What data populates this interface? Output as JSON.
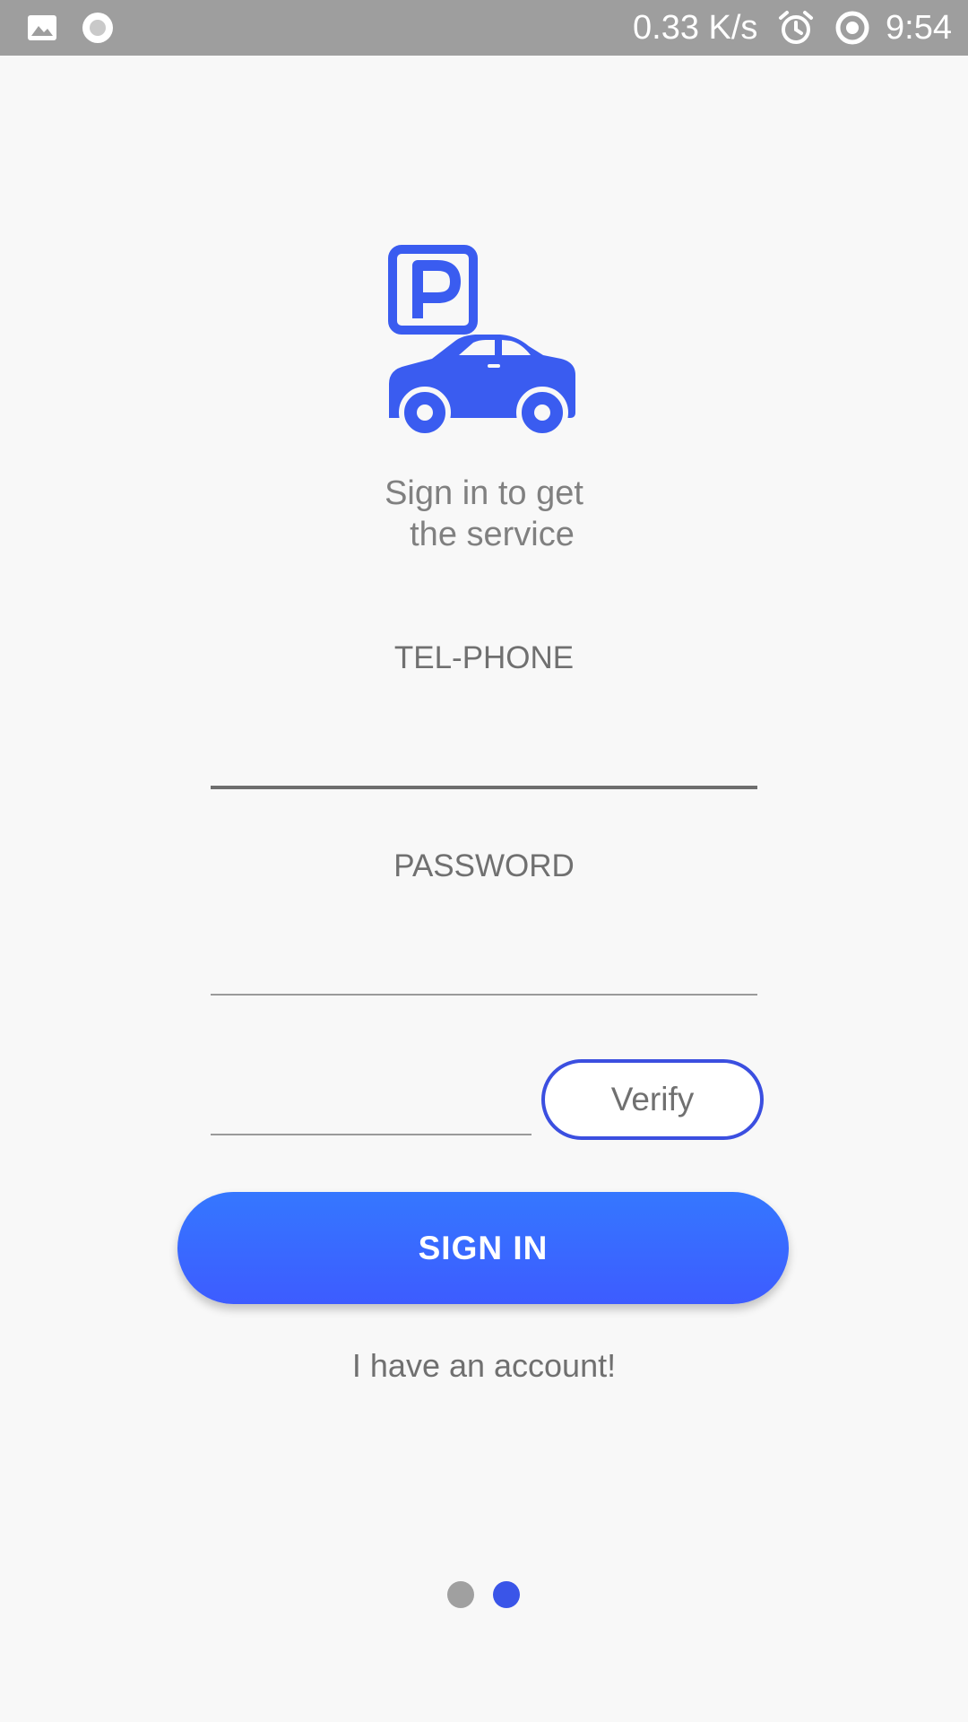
{
  "status_bar": {
    "left_icons": [
      "image-icon",
      "record-icon"
    ],
    "network_speed": "0.33 K/s",
    "right_icons": [
      "alarm-icon",
      "sync-icon"
    ],
    "time": "9:54"
  },
  "logo": {
    "icons": [
      "parking-sign-icon",
      "car-icon"
    ],
    "color": "#3a5cf0"
  },
  "subtitle": {
    "line1": "Sign in to get",
    "line2": "the service"
  },
  "form": {
    "phone": {
      "label": "TEL-PHONE",
      "value": ""
    },
    "password": {
      "label": "PASSWORD",
      "value": ""
    },
    "verify_code": {
      "value": ""
    },
    "verify_button": "Verify",
    "signin_button": "SIGN IN",
    "account_link": "I have an account!"
  },
  "pager": {
    "count": 2,
    "active_index": 1,
    "active_color": "#3a55e8",
    "inactive_color": "#a0a0a0"
  },
  "colors": {
    "accent": "#3a5cf0",
    "status_bar": "#9e9e9e",
    "background": "#f8f8f8"
  }
}
